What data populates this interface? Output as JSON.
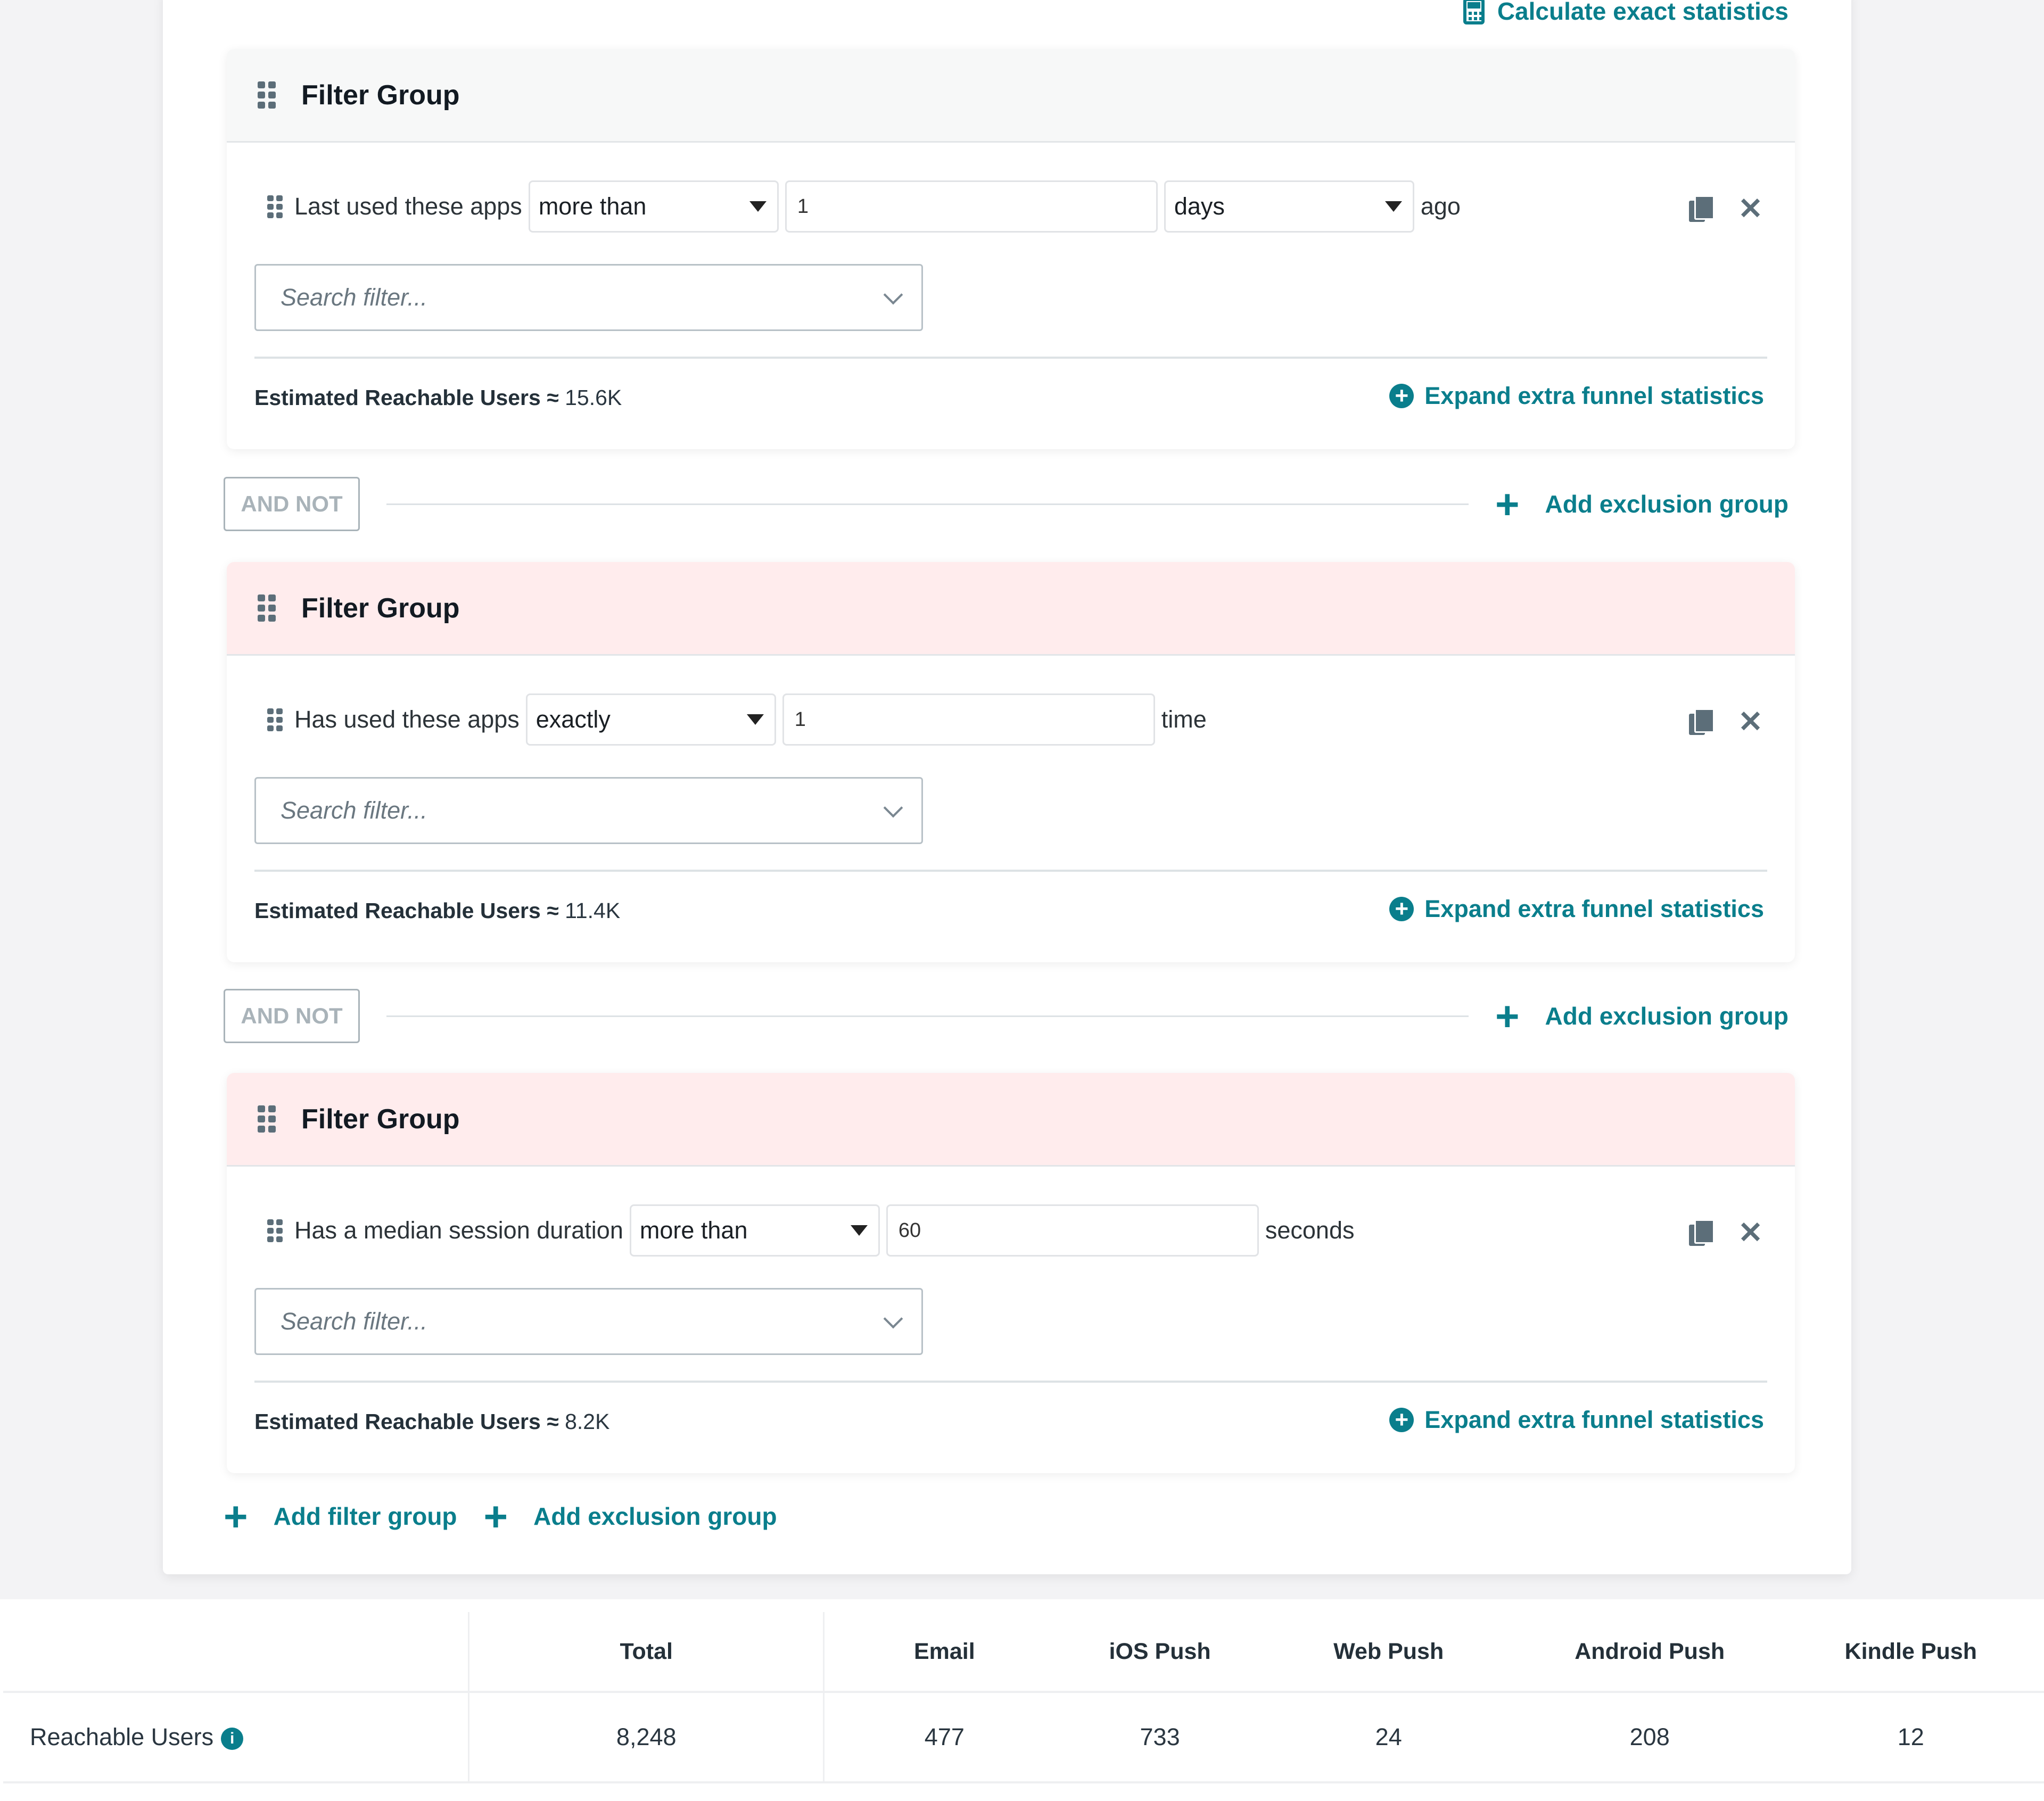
{
  "header": {
    "calculate_label": "Calculate exact statistics",
    "calculate_icon": "calculator-icon"
  },
  "groups": [
    {
      "title": "Filter Group",
      "type": "include",
      "filter": {
        "label": "Last used these apps",
        "operator": "more than",
        "value": "1",
        "unit": "days",
        "suffix": "ago"
      },
      "search_placeholder": "Search filter...",
      "estimate_label": "Estimated Reachable Users ≈",
      "estimate_value": "15.6K",
      "expand_label": "Expand extra funnel statistics"
    },
    {
      "title": "Filter Group",
      "type": "exclude",
      "filter": {
        "label": "Has used these apps",
        "operator": "exactly",
        "value": "1",
        "suffix": "time"
      },
      "search_placeholder": "Search filter...",
      "estimate_label": "Estimated Reachable Users ≈",
      "estimate_value": "11.4K",
      "expand_label": "Expand extra funnel statistics"
    },
    {
      "title": "Filter Group",
      "type": "exclude",
      "filter": {
        "label": "Has a median session duration",
        "operator": "more than",
        "value": "60",
        "suffix": "seconds"
      },
      "search_placeholder": "Search filter...",
      "estimate_label": "Estimated Reachable Users ≈",
      "estimate_value": "8.2K",
      "expand_label": "Expand extra funnel statistics"
    }
  ],
  "connectors": [
    {
      "label": "AND NOT",
      "action": "Add exclusion group"
    },
    {
      "label": "AND NOT",
      "action": "Add exclusion group"
    }
  ],
  "footer_actions": {
    "add_filter_group": "Add filter group",
    "add_exclusion_group": "Add exclusion group"
  },
  "stats": {
    "columns": [
      "",
      "Total",
      "Email",
      "iOS Push",
      "Web Push",
      "Android Push",
      "Kindle Push"
    ],
    "row_label": "Reachable Users",
    "values": [
      "8,248",
      "477",
      "733",
      "24",
      "208",
      "12"
    ]
  },
  "colors": {
    "accent": "#0a7e8c",
    "exclusion_header": "#ffeced",
    "include_header": "#f7f8f8"
  }
}
